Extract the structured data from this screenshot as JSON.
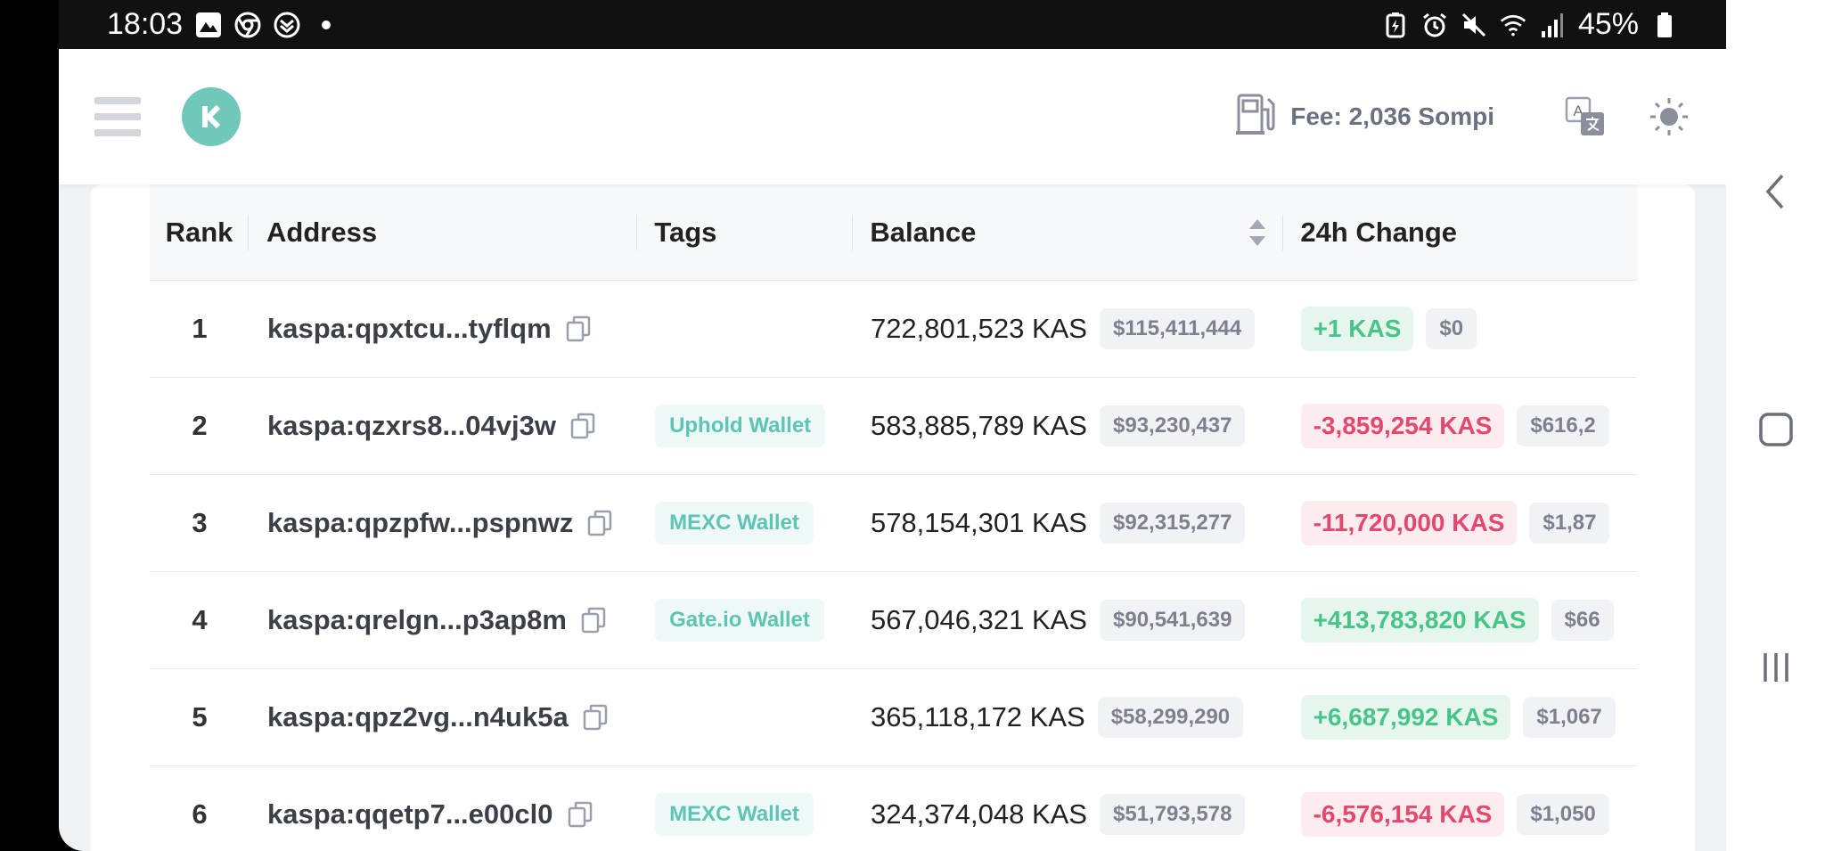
{
  "status_bar": {
    "time": "18:03",
    "battery": "45%",
    "left_icons": [
      "gallery-icon",
      "chrome-icon",
      "shield-download-icon",
      "dot-icon"
    ],
    "right_icons": [
      "battery-saver-icon",
      "alarm-icon",
      "mute-icon",
      "wifi-icon",
      "signal-icon",
      "battery-icon"
    ]
  },
  "header": {
    "fee_label": "Fee: 2,036 Sompi",
    "logo_color": "#70c7ba"
  },
  "table": {
    "columns": {
      "rank": "Rank",
      "address": "Address",
      "tags": "Tags",
      "balance": "Balance",
      "change": "24h Change"
    },
    "rows": [
      {
        "rank": "1",
        "address": "kaspa:qpxtcu...tyflqm",
        "tag": "",
        "balance": "722,801,523 KAS",
        "usd": "$115,411,444",
        "change": "+1 KAS",
        "change_usd": "$0",
        "direction": "pos"
      },
      {
        "rank": "2",
        "address": "kaspa:qzxrs8...04vj3w",
        "tag": "Uphold Wallet",
        "balance": "583,885,789 KAS",
        "usd": "$93,230,437",
        "change": "-3,859,254 KAS",
        "change_usd": "$616,2",
        "direction": "neg"
      },
      {
        "rank": "3",
        "address": "kaspa:qpzpfw...pspnwz",
        "tag": "MEXC Wallet",
        "balance": "578,154,301 KAS",
        "usd": "$92,315,277",
        "change": "-11,720,000 KAS",
        "change_usd": "$1,87",
        "direction": "neg"
      },
      {
        "rank": "4",
        "address": "kaspa:qrelgn...p3ap8m",
        "tag": "Gate.io Wallet",
        "balance": "567,046,321 KAS",
        "usd": "$90,541,639",
        "change": "+413,783,820 KAS",
        "change_usd": "$66",
        "direction": "pos"
      },
      {
        "rank": "5",
        "address": "kaspa:qpz2vg...n4uk5a",
        "tag": "",
        "balance": "365,118,172 KAS",
        "usd": "$58,299,290",
        "change": "+6,687,992 KAS",
        "change_usd": "$1,067",
        "direction": "pos"
      },
      {
        "rank": "6",
        "address": "kaspa:qqetp7...e00cl0",
        "tag": "MEXC Wallet",
        "balance": "324,374,048 KAS",
        "usd": "$51,793,578",
        "change": "-6,576,154 KAS",
        "change_usd": "$1,050",
        "direction": "neg"
      }
    ]
  },
  "colors": {
    "accent": "#70c7ba",
    "positive": "#47c587",
    "negative": "#e4486d"
  }
}
